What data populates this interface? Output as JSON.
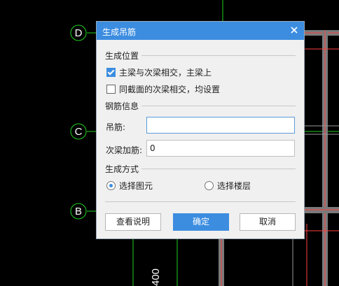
{
  "background": {
    "axis_labels": [
      "D",
      "C",
      "B"
    ],
    "dimension_text": "400"
  },
  "dialog": {
    "title": "生成吊筋",
    "close_glyph": "×",
    "section_position": {
      "label": "生成位置",
      "options": [
        {
          "label": "主梁与次梁相交，主梁上",
          "checked": true
        },
        {
          "label": "同截面的次梁相交，均设置",
          "checked": false
        }
      ]
    },
    "section_rebar": {
      "label": "钢筋信息",
      "hanger_label": "吊筋:",
      "hanger_value": "",
      "secondary_label": "次梁加筋:",
      "secondary_value": "0"
    },
    "section_method": {
      "label": "生成方式",
      "options": [
        {
          "label": "选择图元",
          "selected": true
        },
        {
          "label": "选择楼层",
          "selected": false
        }
      ]
    },
    "buttons": {
      "help": "查看说明",
      "ok": "确定",
      "cancel": "取消"
    }
  },
  "colors": {
    "accent": "#3c8de0",
    "cad_green": "#1fd11f",
    "cad_red": "#ff4040"
  }
}
